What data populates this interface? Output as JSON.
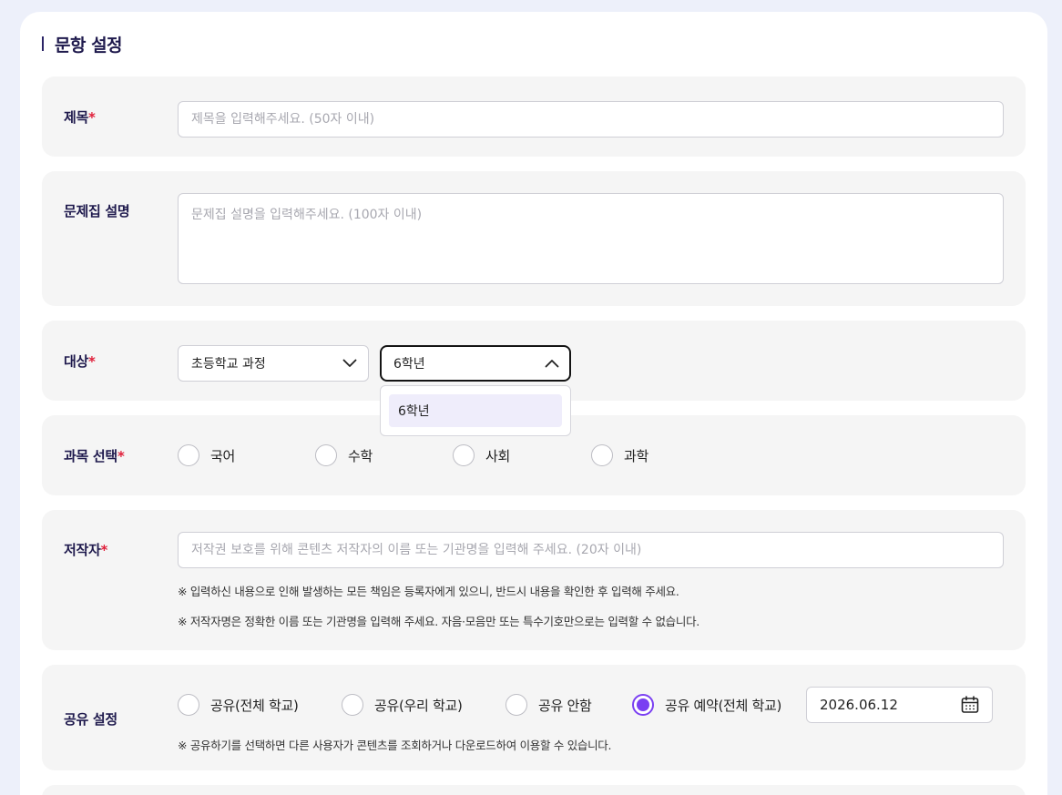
{
  "section": {
    "title": "문항 설정"
  },
  "title_field": {
    "label": "제목",
    "required_mark": "*",
    "placeholder": "제목을 입력해주세요. (50자 이내)"
  },
  "description_field": {
    "label": "문제집 설명",
    "placeholder": "문제집 설명을 입력해주세요. (100자 이내)"
  },
  "target_field": {
    "label": "대상",
    "required_mark": "*",
    "course_select": "초등학교 과정",
    "grade_select": "6학년",
    "grade_options": [
      "6학년"
    ]
  },
  "subject_field": {
    "label": "과목 선택",
    "required_mark": "*",
    "options": [
      "국어",
      "수학",
      "사회",
      "과학"
    ]
  },
  "author_field": {
    "label": "저작자",
    "required_mark": "*",
    "placeholder": "저작권 보호를 위해 콘텐츠 저작자의 이름 또는 기관명을 입력해 주세요. (20자 이내)",
    "notes": [
      "※ 입력하신 내용으로 인해 발생하는 모든 책임은 등록자에게 있으니, 반드시 내용을 확인한 후 입력해 주세요.",
      "※ 저작자명은 정확한 이름 또는 기관명을 입력해 주세요. 자음·모음만 또는 특수기호만으로는 입력할 수 없습니다."
    ]
  },
  "share_field": {
    "label": "공유 설정",
    "options": [
      "공유(전체 학교)",
      "공유(우리 학교)",
      "공유 안함",
      "공유 예약(전체 학교)"
    ],
    "selected": "공유 예약(전체 학교)",
    "date": "2026.06.12",
    "note": "※ 공유하기를 선택하면 다른 사용자가 콘텐츠를 조회하거나 다운로드하여 이용할 수 있습니다."
  },
  "colors": {
    "accent": "#7a3ff2",
    "required": "#e0203b",
    "label": "#1f1a4d",
    "background": "#edf0fa",
    "panel": "#f5f5f5"
  },
  "icons": {
    "select_closed": "chevron-down-icon",
    "select_open": "chevron-up-icon",
    "date": "calendar-icon"
  }
}
